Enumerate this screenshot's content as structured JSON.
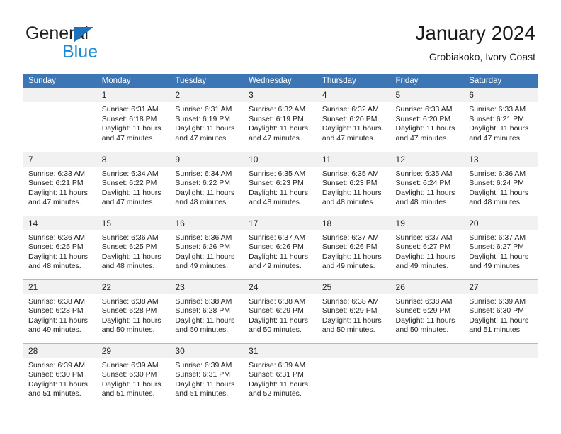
{
  "brand": {
    "name_part1": "General",
    "name_part2": "Blue",
    "triangle_color": "#1c72bd",
    "blue_text_color": "#1c8ad4"
  },
  "header": {
    "title": "January 2024",
    "subtitle": "Grobiakoko, Ivory Coast",
    "header_bg_color": "#3c76b4",
    "daynum_bg_color": "#f1f1f1"
  },
  "weekday_headers": [
    "Sunday",
    "Monday",
    "Tuesday",
    "Wednesday",
    "Thursday",
    "Friday",
    "Saturday"
  ],
  "weeks": [
    [
      {
        "day": "",
        "sunrise": "",
        "sunset": "",
        "daylight1": "",
        "daylight2": ""
      },
      {
        "day": "1",
        "sunrise": "Sunrise: 6:31 AM",
        "sunset": "Sunset: 6:18 PM",
        "daylight1": "Daylight: 11 hours",
        "daylight2": "and 47 minutes."
      },
      {
        "day": "2",
        "sunrise": "Sunrise: 6:31 AM",
        "sunset": "Sunset: 6:19 PM",
        "daylight1": "Daylight: 11 hours",
        "daylight2": "and 47 minutes."
      },
      {
        "day": "3",
        "sunrise": "Sunrise: 6:32 AM",
        "sunset": "Sunset: 6:19 PM",
        "daylight1": "Daylight: 11 hours",
        "daylight2": "and 47 minutes."
      },
      {
        "day": "4",
        "sunrise": "Sunrise: 6:32 AM",
        "sunset": "Sunset: 6:20 PM",
        "daylight1": "Daylight: 11 hours",
        "daylight2": "and 47 minutes."
      },
      {
        "day": "5",
        "sunrise": "Sunrise: 6:33 AM",
        "sunset": "Sunset: 6:20 PM",
        "daylight1": "Daylight: 11 hours",
        "daylight2": "and 47 minutes."
      },
      {
        "day": "6",
        "sunrise": "Sunrise: 6:33 AM",
        "sunset": "Sunset: 6:21 PM",
        "daylight1": "Daylight: 11 hours",
        "daylight2": "and 47 minutes."
      }
    ],
    [
      {
        "day": "7",
        "sunrise": "Sunrise: 6:33 AM",
        "sunset": "Sunset: 6:21 PM",
        "daylight1": "Daylight: 11 hours",
        "daylight2": "and 47 minutes."
      },
      {
        "day": "8",
        "sunrise": "Sunrise: 6:34 AM",
        "sunset": "Sunset: 6:22 PM",
        "daylight1": "Daylight: 11 hours",
        "daylight2": "and 47 minutes."
      },
      {
        "day": "9",
        "sunrise": "Sunrise: 6:34 AM",
        "sunset": "Sunset: 6:22 PM",
        "daylight1": "Daylight: 11 hours",
        "daylight2": "and 48 minutes."
      },
      {
        "day": "10",
        "sunrise": "Sunrise: 6:35 AM",
        "sunset": "Sunset: 6:23 PM",
        "daylight1": "Daylight: 11 hours",
        "daylight2": "and 48 minutes."
      },
      {
        "day": "11",
        "sunrise": "Sunrise: 6:35 AM",
        "sunset": "Sunset: 6:23 PM",
        "daylight1": "Daylight: 11 hours",
        "daylight2": "and 48 minutes."
      },
      {
        "day": "12",
        "sunrise": "Sunrise: 6:35 AM",
        "sunset": "Sunset: 6:24 PM",
        "daylight1": "Daylight: 11 hours",
        "daylight2": "and 48 minutes."
      },
      {
        "day": "13",
        "sunrise": "Sunrise: 6:36 AM",
        "sunset": "Sunset: 6:24 PM",
        "daylight1": "Daylight: 11 hours",
        "daylight2": "and 48 minutes."
      }
    ],
    [
      {
        "day": "14",
        "sunrise": "Sunrise: 6:36 AM",
        "sunset": "Sunset: 6:25 PM",
        "daylight1": "Daylight: 11 hours",
        "daylight2": "and 48 minutes."
      },
      {
        "day": "15",
        "sunrise": "Sunrise: 6:36 AM",
        "sunset": "Sunset: 6:25 PM",
        "daylight1": "Daylight: 11 hours",
        "daylight2": "and 48 minutes."
      },
      {
        "day": "16",
        "sunrise": "Sunrise: 6:36 AM",
        "sunset": "Sunset: 6:26 PM",
        "daylight1": "Daylight: 11 hours",
        "daylight2": "and 49 minutes."
      },
      {
        "day": "17",
        "sunrise": "Sunrise: 6:37 AM",
        "sunset": "Sunset: 6:26 PM",
        "daylight1": "Daylight: 11 hours",
        "daylight2": "and 49 minutes."
      },
      {
        "day": "18",
        "sunrise": "Sunrise: 6:37 AM",
        "sunset": "Sunset: 6:26 PM",
        "daylight1": "Daylight: 11 hours",
        "daylight2": "and 49 minutes."
      },
      {
        "day": "19",
        "sunrise": "Sunrise: 6:37 AM",
        "sunset": "Sunset: 6:27 PM",
        "daylight1": "Daylight: 11 hours",
        "daylight2": "and 49 minutes."
      },
      {
        "day": "20",
        "sunrise": "Sunrise: 6:37 AM",
        "sunset": "Sunset: 6:27 PM",
        "daylight1": "Daylight: 11 hours",
        "daylight2": "and 49 minutes."
      }
    ],
    [
      {
        "day": "21",
        "sunrise": "Sunrise: 6:38 AM",
        "sunset": "Sunset: 6:28 PM",
        "daylight1": "Daylight: 11 hours",
        "daylight2": "and 49 minutes."
      },
      {
        "day": "22",
        "sunrise": "Sunrise: 6:38 AM",
        "sunset": "Sunset: 6:28 PM",
        "daylight1": "Daylight: 11 hours",
        "daylight2": "and 50 minutes."
      },
      {
        "day": "23",
        "sunrise": "Sunrise: 6:38 AM",
        "sunset": "Sunset: 6:28 PM",
        "daylight1": "Daylight: 11 hours",
        "daylight2": "and 50 minutes."
      },
      {
        "day": "24",
        "sunrise": "Sunrise: 6:38 AM",
        "sunset": "Sunset: 6:29 PM",
        "daylight1": "Daylight: 11 hours",
        "daylight2": "and 50 minutes."
      },
      {
        "day": "25",
        "sunrise": "Sunrise: 6:38 AM",
        "sunset": "Sunset: 6:29 PM",
        "daylight1": "Daylight: 11 hours",
        "daylight2": "and 50 minutes."
      },
      {
        "day": "26",
        "sunrise": "Sunrise: 6:38 AM",
        "sunset": "Sunset: 6:29 PM",
        "daylight1": "Daylight: 11 hours",
        "daylight2": "and 50 minutes."
      },
      {
        "day": "27",
        "sunrise": "Sunrise: 6:39 AM",
        "sunset": "Sunset: 6:30 PM",
        "daylight1": "Daylight: 11 hours",
        "daylight2": "and 51 minutes."
      }
    ],
    [
      {
        "day": "28",
        "sunrise": "Sunrise: 6:39 AM",
        "sunset": "Sunset: 6:30 PM",
        "daylight1": "Daylight: 11 hours",
        "daylight2": "and 51 minutes."
      },
      {
        "day": "29",
        "sunrise": "Sunrise: 6:39 AM",
        "sunset": "Sunset: 6:30 PM",
        "daylight1": "Daylight: 11 hours",
        "daylight2": "and 51 minutes."
      },
      {
        "day": "30",
        "sunrise": "Sunrise: 6:39 AM",
        "sunset": "Sunset: 6:31 PM",
        "daylight1": "Daylight: 11 hours",
        "daylight2": "and 51 minutes."
      },
      {
        "day": "31",
        "sunrise": "Sunrise: 6:39 AM",
        "sunset": "Sunset: 6:31 PM",
        "daylight1": "Daylight: 11 hours",
        "daylight2": "and 52 minutes."
      },
      {
        "day": "",
        "sunrise": "",
        "sunset": "",
        "daylight1": "",
        "daylight2": ""
      },
      {
        "day": "",
        "sunrise": "",
        "sunset": "",
        "daylight1": "",
        "daylight2": ""
      },
      {
        "day": "",
        "sunrise": "",
        "sunset": "",
        "daylight1": "",
        "daylight2": ""
      }
    ]
  ]
}
